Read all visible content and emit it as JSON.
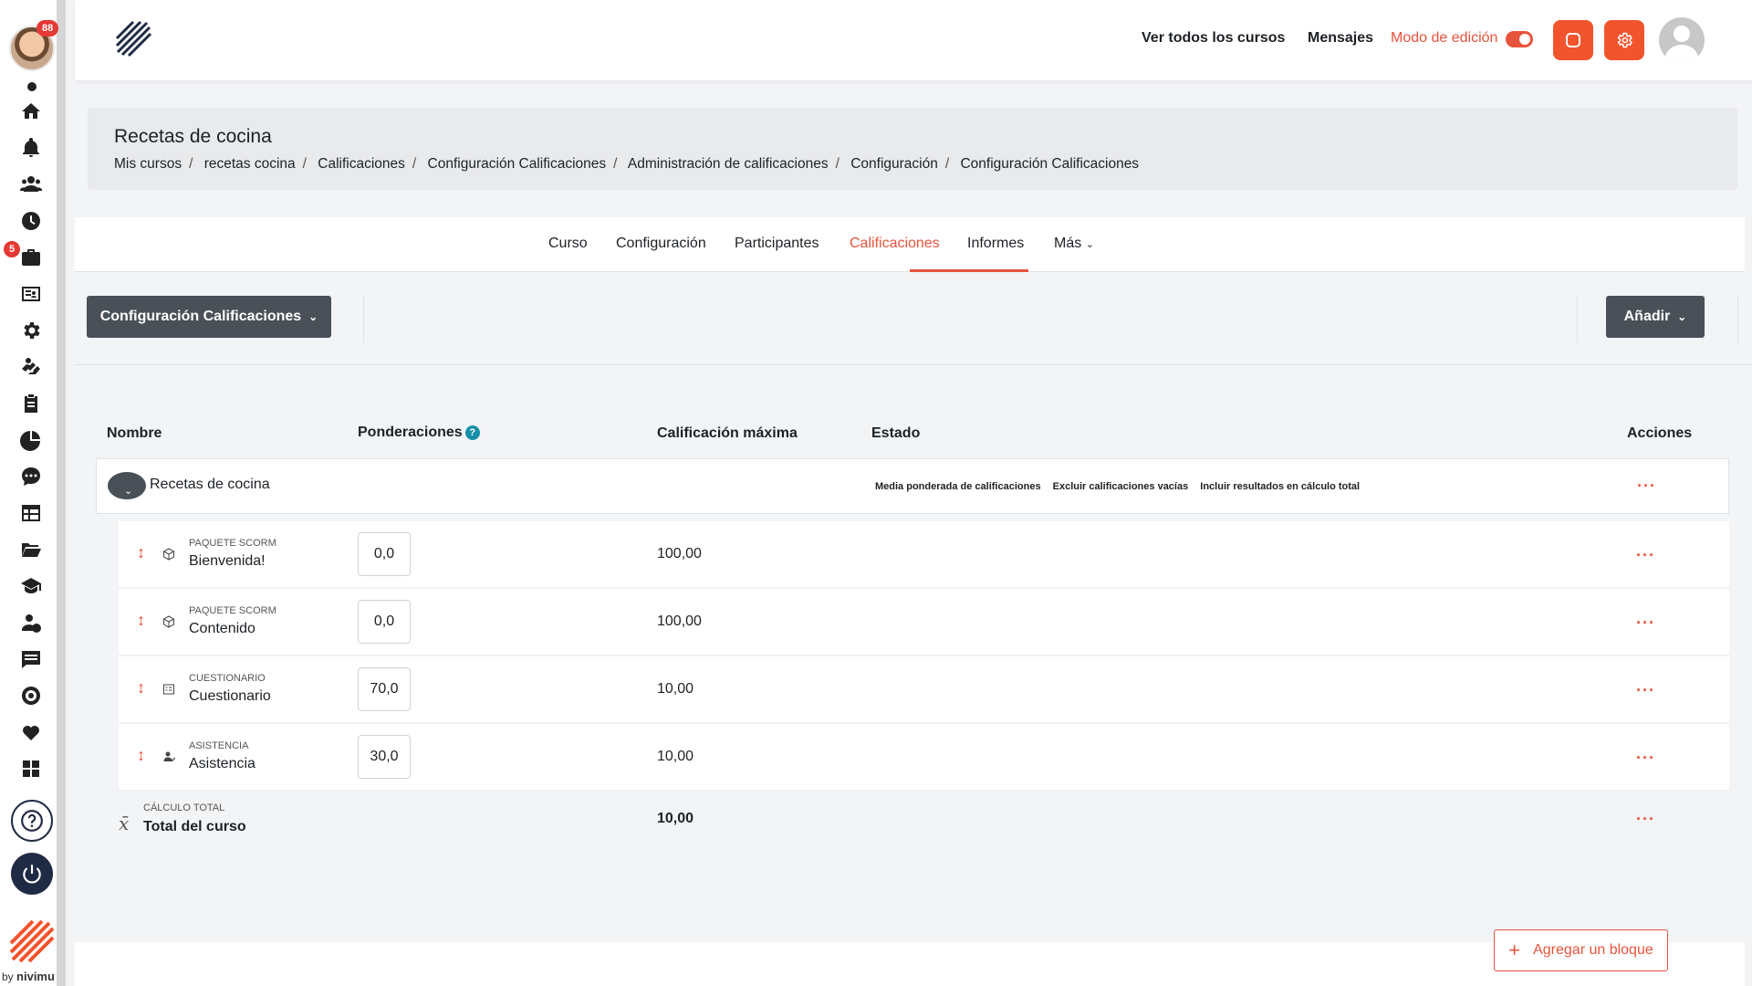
{
  "rail": {
    "avatar_badge": "88",
    "briefcase_badge": "5",
    "icons": [
      "home-icon",
      "bell-icon",
      "users-icon",
      "clock-icon",
      "briefcase-icon",
      "id-card-icon",
      "gear-icon",
      "handshake-money-icon",
      "clipboard-icon",
      "pie-chart-icon",
      "chat-icon",
      "calendar-table-icon",
      "folder-icon",
      "graduation-cap-icon",
      "user-dollar-icon",
      "message-list-icon",
      "target-icon",
      "heart-hands-icon",
      "grid-icon"
    ],
    "by_prefix": "by",
    "by_brand": "nivimu"
  },
  "topbar": {
    "all_courses": "Ver todos los cursos",
    "messages": "Mensajes",
    "edit_mode": "Modo de edición",
    "accent_color": "#e8533b"
  },
  "header": {
    "title": "Recetas de cocina",
    "breadcrumb": [
      "Mis cursos",
      "recetas cocina",
      "Calificaciones",
      "Configuración Calificaciones",
      "Administración de calificaciones",
      "Configuración",
      "Configuración Calificaciones"
    ]
  },
  "tabs": [
    {
      "label": "Curso"
    },
    {
      "label": "Configuración"
    },
    {
      "label": "Participantes"
    },
    {
      "label": "Calificaciones",
      "active": true
    },
    {
      "label": "Informes"
    },
    {
      "label": "Más"
    }
  ],
  "actionbar": {
    "select_label": "Configuración Calificaciones",
    "add_label": "Añadir"
  },
  "table": {
    "headers": {
      "name": "Nombre",
      "weights": "Ponderaciones",
      "max": "Calificación máxima",
      "status": "Estado",
      "actions": "Acciones"
    },
    "category": {
      "name": "Recetas de cocina",
      "status_tags": [
        "Media ponderada de calificaciones",
        "Excluir calificaciones vacías",
        "Incluir resultados en cálculo total"
      ]
    },
    "items": [
      {
        "type": "PAQUETE SCORM",
        "name": "Bienvenida!",
        "weight": "0,0",
        "max": "100,00"
      },
      {
        "type": "PAQUETE SCORM",
        "name": "Contenido",
        "weight": "0,0",
        "max": "100,00"
      },
      {
        "type": "CUESTIONARIO",
        "name": "Cuestionario",
        "weight": "70,0",
        "max": "10,00"
      },
      {
        "type": "ASISTENCIA",
        "name": "Asistencia",
        "weight": "30,0",
        "max": "10,00"
      }
    ],
    "total": {
      "type": "CÁLCULO TOTAL",
      "name": "Total del curso",
      "max": "10,00"
    }
  },
  "add_block": "Agregar un bloque"
}
